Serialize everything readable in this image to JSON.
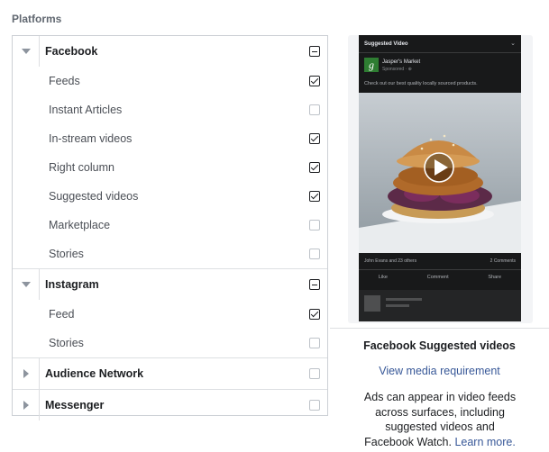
{
  "section_title": "Platforms",
  "platforms": {
    "facebook": {
      "label": "Facebook",
      "state": "mixed",
      "items": [
        {
          "label": "Feeds",
          "checked": true
        },
        {
          "label": "Instant Articles",
          "checked": false
        },
        {
          "label": "In-stream videos",
          "checked": true
        },
        {
          "label": "Right column",
          "checked": true
        },
        {
          "label": "Suggested videos",
          "checked": true
        },
        {
          "label": "Marketplace",
          "checked": false
        },
        {
          "label": "Stories",
          "checked": false
        }
      ]
    },
    "instagram": {
      "label": "Instagram",
      "state": "mixed",
      "items": [
        {
          "label": "Feed",
          "checked": true
        },
        {
          "label": "Stories",
          "checked": false
        }
      ]
    },
    "audience_network": {
      "label": "Audience Network",
      "state": "unchecked"
    },
    "messenger": {
      "label": "Messenger",
      "state": "unchecked"
    }
  },
  "preview": {
    "header": "Suggested Video",
    "brand": "Jasper's Market",
    "brand_initial": "g",
    "sponsored": "Sponsored · ⊕",
    "copy": "Check out our best quality locally sourced products.",
    "reactions": "John Evans and 23 others",
    "comments": "2 Comments",
    "like": "Like",
    "comment": "Comment",
    "share": "Share"
  },
  "caption": {
    "title": "Facebook Suggested videos",
    "link": "View media requirement",
    "desc_1": "Ads can appear in video feeds",
    "desc_2": "across surfaces, including",
    "desc_3": "suggested videos and",
    "desc_4": "Facebook Watch.",
    "learn_more": "Learn more."
  }
}
